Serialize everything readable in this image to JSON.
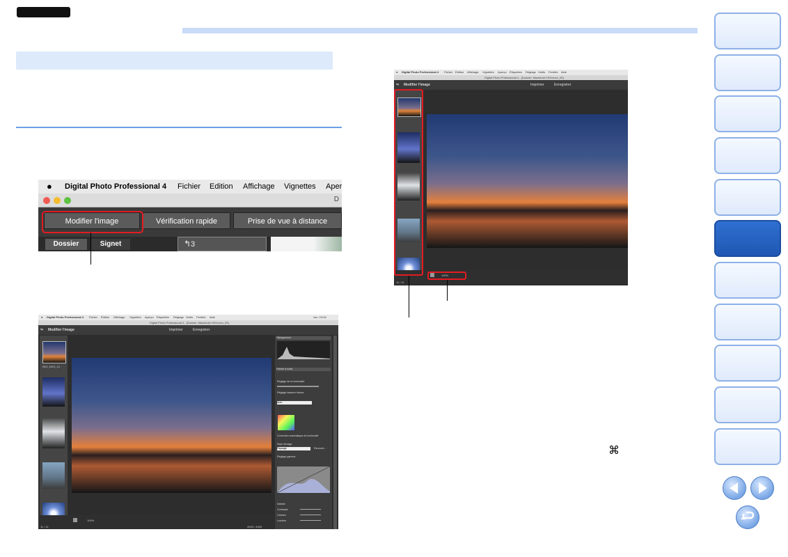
{
  "menu_crop": {
    "app_name": "Digital Photo Professional 4",
    "menu_items": [
      "Fichier",
      "Edition",
      "Affichage",
      "Vignettes",
      "Aper"
    ],
    "window_title_fragment": "D",
    "tabs": [
      "Modifier l'image",
      "Vérification rapide",
      "Prise de vue à distance"
    ],
    "lower_tabs": [
      "Dossier",
      "Signet"
    ],
    "partial_label": "3"
  },
  "small_ui": {
    "window_title": "Digital Photo Professional 4 - [Dossier: Macintosh HD/xxxxx_05]",
    "menu_items": [
      "Digital Photo Professional 4",
      "Fichier",
      "Édition",
      "Affichage",
      "Vignettes",
      "Aperçu",
      "Étiquettes",
      "Réglage",
      "Outils",
      "Fenêtre",
      "Aide"
    ],
    "menu_clock": "ven. 19:34",
    "tab_label": "Modifier l'image",
    "print_label": "Imprimer",
    "save_label": "Enregistrer",
    "zoom_label": "100%",
    "status_left": "11 / 11",
    "status_right": "4949 / 4949",
    "thumb_label": "IMG_0001_01",
    "panel": {
      "histogram": "Histogramme",
      "tools": "Palette d'outils",
      "brightness": "Réglage de la luminosité",
      "white_balance": "Réglage balance blancs",
      "preset": "Auto",
      "picture_style": "Style d'image",
      "picture_style_value": "Paysage",
      "browse": "Parcourir...",
      "auto_lighting": "Correction automatique de luminosité",
      "curve_label": "Réglage gamma",
      "detail": "Netteté",
      "contrast": "Contraste",
      "shadows": "Ombres",
      "highlights": "Lumière"
    }
  },
  "large_ui": {
    "menu_items": [
      "Digital Photo Professional 4",
      "Fichier",
      "Édition",
      "Affichage",
      "Vignettes",
      "Aperçu",
      "Étiquettes",
      "Réglage",
      "Outils",
      "Fenêtre",
      "Aide"
    ],
    "window_title": "Digital Photo Professional 4 - [Dossier: Macintosh HD/xxxxx_05]",
    "tab_label": "Modifier l'image",
    "print_label": "Imprimer",
    "save_label": "Enregistrer",
    "zoom_label": "100%",
    "status_left": "11 / 11"
  },
  "body_text": {
    "command_glyph": "⌘"
  }
}
